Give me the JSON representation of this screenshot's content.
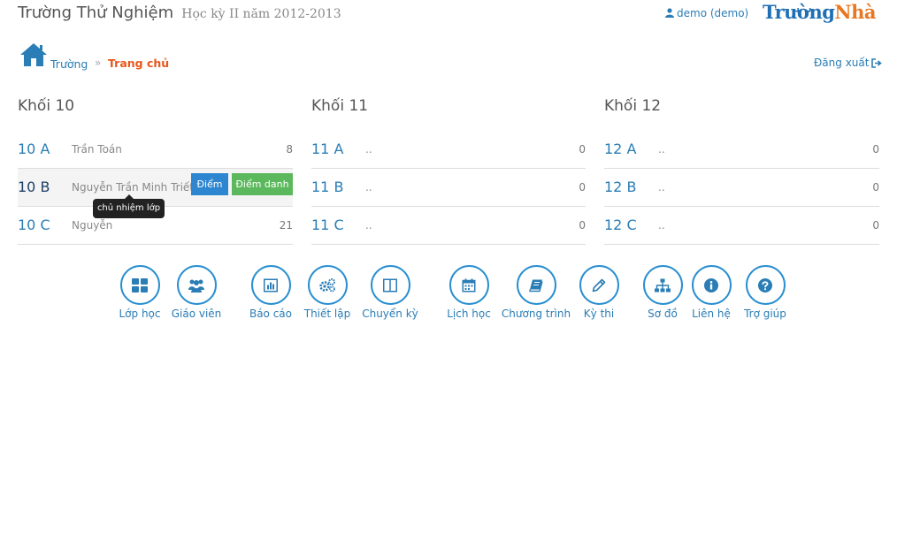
{
  "header": {
    "school": "Trường Thử Nghiệm",
    "term": "Học kỳ II năm 2012-2013",
    "user": "demo (demo)",
    "logo_a": "Trường",
    "logo_b": "Nhà"
  },
  "breadcrumb": {
    "home": "Trường",
    "sep": "»",
    "current": "Trang chủ"
  },
  "logout": "Đăng xuất",
  "grades": [
    {
      "title": "Khối 10",
      "rows": [
        {
          "name": "10 A",
          "teacher": "Trần Toán",
          "count": "8"
        },
        {
          "name": "10 B",
          "teacher": "Nguyễn Trần Minh Triết",
          "count": ""
        },
        {
          "name": "10 C",
          "teacher": "Nguyễn",
          "count": "21"
        }
      ]
    },
    {
      "title": "Khối 11",
      "rows": [
        {
          "name": "11 A",
          "teacher": "..",
          "count": "0"
        },
        {
          "name": "11 B",
          "teacher": "..",
          "count": "0"
        },
        {
          "name": "11 C",
          "teacher": "..",
          "count": "0"
        }
      ]
    },
    {
      "title": "Khối 12",
      "rows": [
        {
          "name": "12 A",
          "teacher": "..",
          "count": "0"
        },
        {
          "name": "12 B",
          "teacher": "..",
          "count": "0"
        },
        {
          "name": "12 C",
          "teacher": "..",
          "count": "0"
        }
      ]
    }
  ],
  "row_actions": {
    "diem": "Điểm",
    "diem_danh": "Điểm danh"
  },
  "tooltip": "chủ nhiệm lớp",
  "menu": [
    {
      "label": "Lớp học",
      "icon": "th-large-icon"
    },
    {
      "label": "Giáo viên",
      "icon": "users-icon"
    },
    {
      "label": "Báo cáo",
      "icon": "bar-chart-icon"
    },
    {
      "label": "Thiết lập",
      "icon": "cogs-icon"
    },
    {
      "label": "Chuyển kỳ",
      "icon": "columns-icon"
    },
    {
      "label": "Lịch học",
      "icon": "calendar-icon"
    },
    {
      "label": "Chương trình",
      "icon": "book-icon"
    },
    {
      "label": "Kỳ thi",
      "icon": "pencil-icon"
    },
    {
      "label": "Sơ đồ",
      "icon": "sitemap-icon"
    },
    {
      "label": "Liên hệ",
      "icon": "info-icon"
    },
    {
      "label": "Trợ giúp",
      "icon": "question-icon"
    }
  ],
  "colors": {
    "accent": "#2a7db5",
    "active": "#e8561b",
    "diem_btn": "#2f86d0",
    "diem_danh_btn": "#5cb85c"
  }
}
